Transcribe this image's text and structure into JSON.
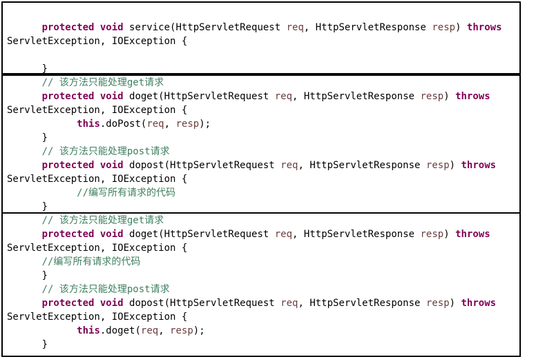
{
  "colors": {
    "keyword": "#7f0055",
    "parameter": "#6a3e3e",
    "comment": "#3f7f5f",
    "text": "#000000",
    "border": "#000000"
  },
  "blocks": [
    {
      "lines": [
        [
          {
            "t": "      "
          },
          {
            "t": "protected",
            "k": "kw"
          },
          {
            "t": " "
          },
          {
            "t": "void",
            "k": "kw"
          },
          {
            "t": " service(HttpServletRequest "
          },
          {
            "t": "req",
            "k": "param"
          },
          {
            "t": ", HttpServletResponse "
          },
          {
            "t": "resp",
            "k": "param"
          },
          {
            "t": ") "
          },
          {
            "t": "throws",
            "k": "kw"
          }
        ],
        [
          {
            "t": "ServletException, IOException {"
          }
        ],
        [],
        [
          {
            "t": "      }"
          }
        ]
      ]
    },
    {
      "lines": [
        [
          {
            "t": "      "
          },
          {
            "t": "// 该方法只能处理get请求",
            "k": "cm"
          }
        ],
        [
          {
            "t": "      "
          },
          {
            "t": "protected",
            "k": "kw"
          },
          {
            "t": " "
          },
          {
            "t": "void",
            "k": "kw"
          },
          {
            "t": " doget(HttpServletRequest "
          },
          {
            "t": "req",
            "k": "param"
          },
          {
            "t": ", HttpServletResponse "
          },
          {
            "t": "resp",
            "k": "param"
          },
          {
            "t": ") "
          },
          {
            "t": "throws",
            "k": "kw"
          }
        ],
        [
          {
            "t": "ServletException, IOException {"
          }
        ],
        [
          {
            "t": "            "
          },
          {
            "t": "this",
            "k": "kw"
          },
          {
            "t": ".doPost("
          },
          {
            "t": "req",
            "k": "param"
          },
          {
            "t": ", "
          },
          {
            "t": "resp",
            "k": "param"
          },
          {
            "t": ");"
          }
        ],
        [
          {
            "t": "      }"
          }
        ],
        [
          {
            "t": "      "
          },
          {
            "t": "// 该方法只能处理post请求",
            "k": "cm"
          }
        ],
        [
          {
            "t": "      "
          },
          {
            "t": "protected",
            "k": "kw"
          },
          {
            "t": " "
          },
          {
            "t": "void",
            "k": "kw"
          },
          {
            "t": " dopost(HttpServletRequest "
          },
          {
            "t": "req",
            "k": "param"
          },
          {
            "t": ", HttpServletResponse "
          },
          {
            "t": "resp",
            "k": "param"
          },
          {
            "t": ") "
          },
          {
            "t": "throws",
            "k": "kw"
          }
        ],
        [
          {
            "t": "ServletException, IOException {"
          }
        ],
        [
          {
            "t": "            "
          },
          {
            "t": "//编写所有请求的代码",
            "k": "cm"
          }
        ],
        [
          {
            "t": "      }"
          }
        ]
      ]
    },
    {
      "lines": [
        [
          {
            "t": "      "
          },
          {
            "t": "// 该方法只能处理get请求",
            "k": "cm"
          }
        ],
        [
          {
            "t": "      "
          },
          {
            "t": "protected",
            "k": "kw"
          },
          {
            "t": " "
          },
          {
            "t": "void",
            "k": "kw"
          },
          {
            "t": " doget(HttpServletRequest "
          },
          {
            "t": "req",
            "k": "param"
          },
          {
            "t": ", HttpServletResponse "
          },
          {
            "t": "resp",
            "k": "param"
          },
          {
            "t": ") "
          },
          {
            "t": "throws",
            "k": "kw"
          }
        ],
        [
          {
            "t": "ServletException, IOException {"
          }
        ],
        [
          {
            "t": "      "
          },
          {
            "t": "//编写所有请求的代码",
            "k": "cm"
          }
        ],
        [
          {
            "t": "      }"
          }
        ],
        [
          {
            "t": "      "
          },
          {
            "t": "// 该方法只能处理post请求",
            "k": "cm"
          }
        ],
        [
          {
            "t": "      "
          },
          {
            "t": "protected",
            "k": "kw"
          },
          {
            "t": " "
          },
          {
            "t": "void",
            "k": "kw"
          },
          {
            "t": " dopost(HttpServletRequest "
          },
          {
            "t": "req",
            "k": "param"
          },
          {
            "t": ", HttpServletResponse "
          },
          {
            "t": "resp",
            "k": "param"
          },
          {
            "t": ") "
          },
          {
            "t": "throws",
            "k": "kw"
          }
        ],
        [
          {
            "t": "ServletException, IOException {"
          }
        ],
        [
          {
            "t": "            "
          },
          {
            "t": "this",
            "k": "kw"
          },
          {
            "t": ".doget("
          },
          {
            "t": "req",
            "k": "param"
          },
          {
            "t": ", "
          },
          {
            "t": "resp",
            "k": "param"
          },
          {
            "t": ");"
          }
        ],
        [
          {
            "t": "      }"
          }
        ]
      ]
    }
  ]
}
